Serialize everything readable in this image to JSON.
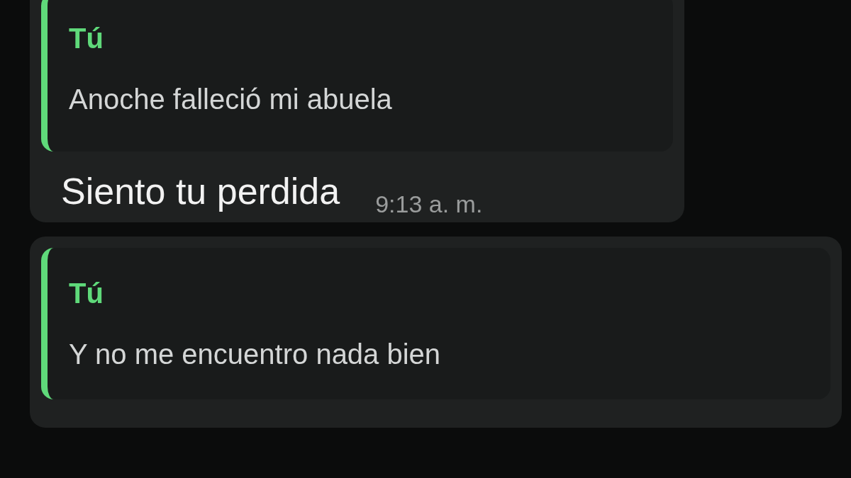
{
  "messages": [
    {
      "quote": {
        "author": "Tú",
        "text": "Anoche falleció mi abuela"
      },
      "text": "Siento tu perdida",
      "time": "9:13 a. m."
    },
    {
      "quote": {
        "author": "Tú",
        "text": "Y no me encuentro nada bien"
      }
    }
  ]
}
